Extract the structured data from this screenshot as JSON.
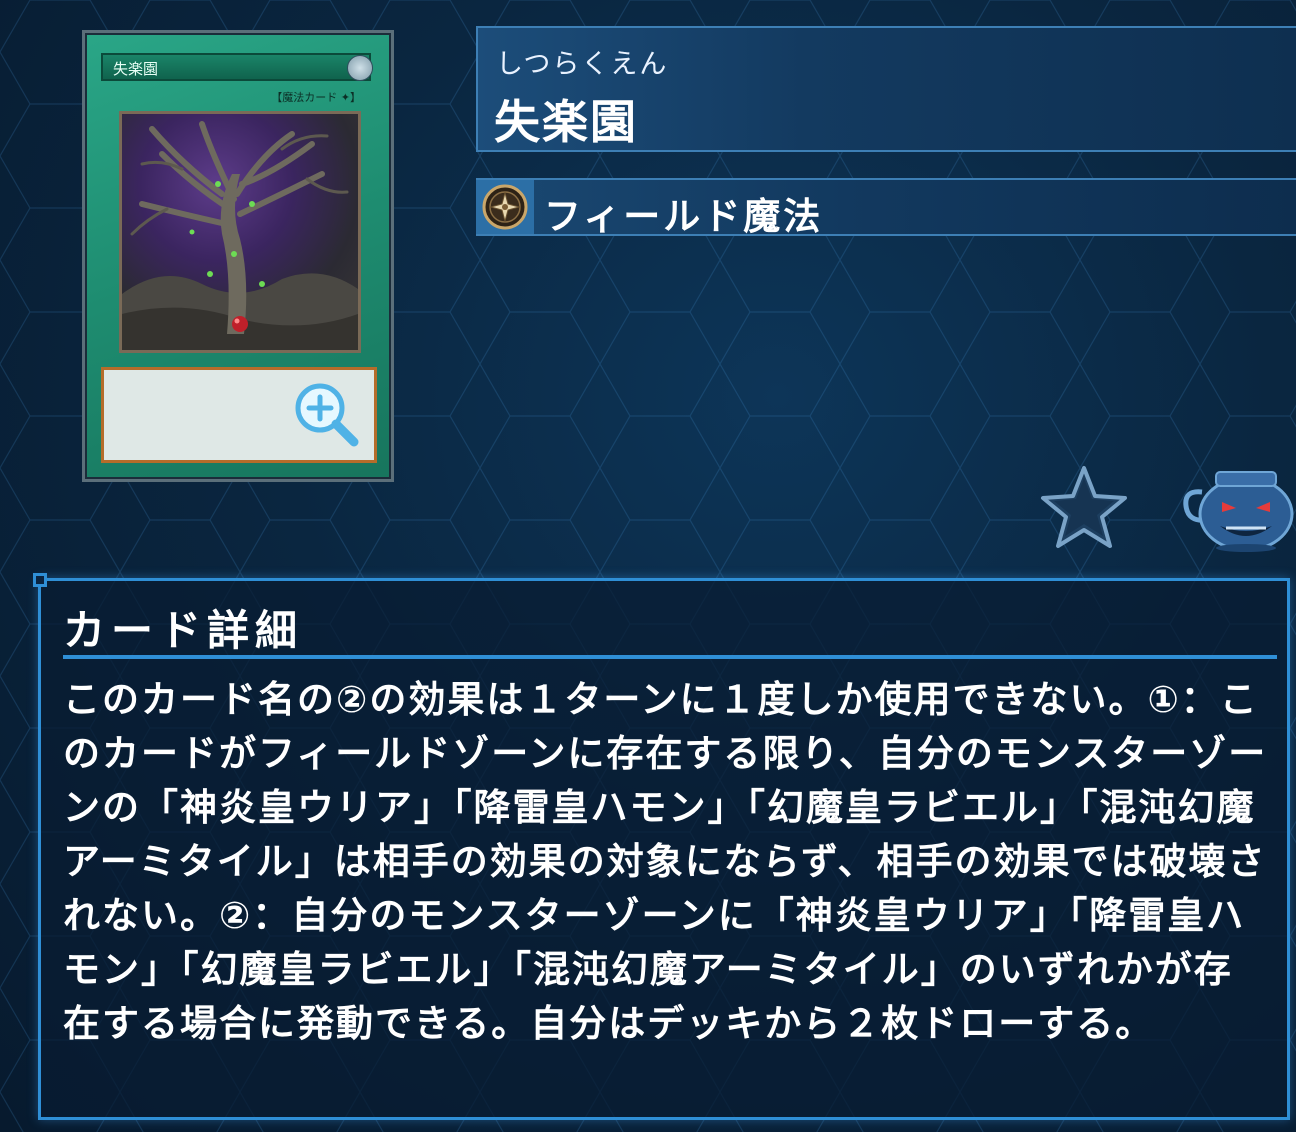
{
  "card": {
    "ruby": "しつらくえん",
    "name": "失楽園",
    "type_label": "フィールド魔法",
    "art_name": "失楽園",
    "art_type_line": "【魔法カード ✦】"
  },
  "details": {
    "heading": "カード詳細",
    "text": "このカード名の②の効果は１ターンに１度しか使用できない。①：このカードがフィールドゾーンに存在する限り、自分のモンスターゾーンの「神炎皇ウリア」「降雷皇ハモン」「幻魔皇ラビエル」「混沌幻魔アーミタイル」は相手の効果の対象にならず、相手の効果では破壊されない。②：自分のモンスターゾーンに「神炎皇ウリア」「降雷皇ハモン」「幻魔皇ラビエル」「混沌幻魔アーミタイル」のいずれかが存在する場合に発動できる。自分はデッキから２枚ドローする。"
  },
  "icons": {
    "type_icon": "field-spell-icon",
    "zoom": "zoom-in-icon",
    "favorite": "star-icon",
    "mascot": "pot-of-greed-icon"
  },
  "colors": {
    "accent_border": "#2f8fd6",
    "card_frame": "#1e8c70",
    "background": "#0a2640"
  }
}
